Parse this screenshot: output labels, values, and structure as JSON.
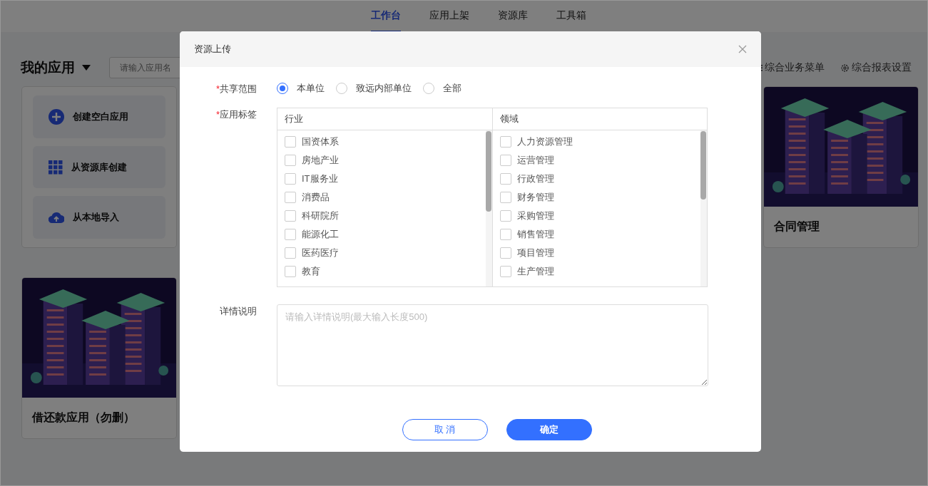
{
  "top_nav": {
    "tabs": [
      {
        "label": "工作台",
        "selected": true
      },
      {
        "label": "应用上架",
        "selected": false
      },
      {
        "label": "资源库",
        "selected": false
      },
      {
        "label": "工具箱",
        "selected": false
      }
    ]
  },
  "page": {
    "title": "我的应用",
    "search": {
      "placeholder": "请输入应用名"
    },
    "links": [
      {
        "label": "综合业务菜单",
        "kind": "menu"
      },
      {
        "label": "综合报表设置",
        "kind": "gear"
      }
    ]
  },
  "create_actions": [
    {
      "label": "创建空白应用",
      "kind": "plus"
    },
    {
      "label": "从资源库创建",
      "kind": "grid"
    },
    {
      "label": "从本地导入",
      "kind": "upload"
    }
  ],
  "app_cards": [
    {
      "title": "合同管理"
    },
    {
      "title": "借还款应用（勿删）"
    }
  ],
  "dialog": {
    "title": "资源上传",
    "scope": {
      "label": "共享范围",
      "required_mark": "*",
      "options": [
        {
          "label": "本单位",
          "selected": true
        },
        {
          "label": "致远内部单位",
          "selected": false
        },
        {
          "label": "全部",
          "selected": false
        }
      ]
    },
    "tags": {
      "label": "应用标签",
      "required_mark": "*",
      "columns": [
        {
          "header": "行业",
          "items": [
            {
              "label": "国资体系",
              "checked": false
            },
            {
              "label": "房地产业",
              "checked": false
            },
            {
              "label": "IT服务业",
              "checked": false
            },
            {
              "label": "消费品",
              "checked": false
            },
            {
              "label": "科研院所",
              "checked": false
            },
            {
              "label": "能源化工",
              "checked": false
            },
            {
              "label": "医药医疗",
              "checked": false
            },
            {
              "label": "教育",
              "checked": false
            }
          ]
        },
        {
          "header": "领域",
          "items": [
            {
              "label": "人力资源管理",
              "checked": false
            },
            {
              "label": "运营管理",
              "checked": false
            },
            {
              "label": "行政管理",
              "checked": false
            },
            {
              "label": "财务管理",
              "checked": false
            },
            {
              "label": "采购管理",
              "checked": false
            },
            {
              "label": "销售管理",
              "checked": false
            },
            {
              "label": "项目管理",
              "checked": false
            },
            {
              "label": "生产管理",
              "checked": false
            }
          ]
        }
      ]
    },
    "description": {
      "label": "详情说明",
      "placeholder": "请输入详情说明(最大输入长度500)"
    },
    "buttons": [
      {
        "label": "取 消",
        "kind": "secondary"
      },
      {
        "label": "确定",
        "kind": "primary"
      }
    ]
  }
}
